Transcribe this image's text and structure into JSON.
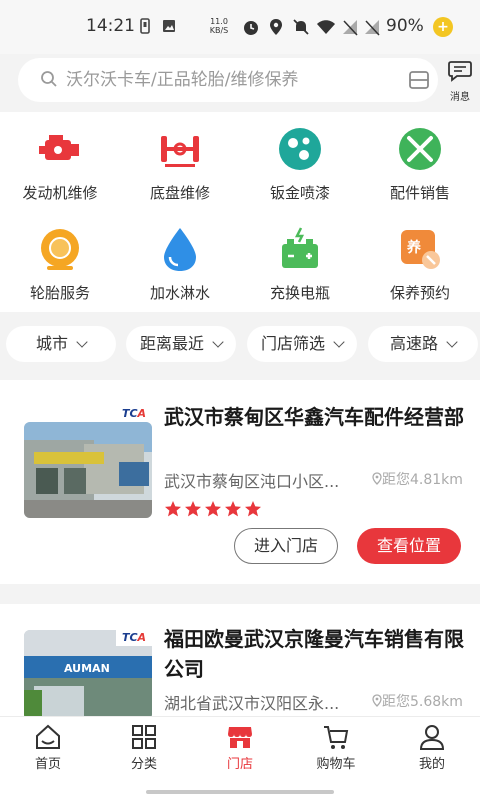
{
  "status_bar": {
    "time": "14:21",
    "network_speed": "11.0 KB/S",
    "battery": "90%"
  },
  "search": {
    "placeholder": "沃尔沃卡车/正品轮胎/维修保养",
    "message_label": "消息"
  },
  "categories": [
    {
      "label": "发动机维修",
      "icon": "engine-icon"
    },
    {
      "label": "底盘维修",
      "icon": "chassis-icon"
    },
    {
      "label": "钣金喷漆",
      "icon": "paint-icon"
    },
    {
      "label": "配件销售",
      "icon": "parts-icon"
    },
    {
      "label": "轮胎服务",
      "icon": "tire-icon"
    },
    {
      "label": "加水淋水",
      "icon": "water-drop-icon"
    },
    {
      "label": "充换电瓶",
      "icon": "battery-icon"
    },
    {
      "label": "保养预约",
      "icon": "maintenance-icon"
    }
  ],
  "filters": [
    {
      "label": "城市"
    },
    {
      "label": "距离最近"
    },
    {
      "label": "门店筛选"
    },
    {
      "label": "高速路"
    }
  ],
  "stores": [
    {
      "name": "武汉市蔡甸区华鑫汽车配件经营部",
      "address": "武汉市蔡甸区沌口小区...",
      "distance": "距您4.81km",
      "rating": 5,
      "badge": "TCA",
      "enter_label": "进入门店",
      "location_label": "查看位置"
    },
    {
      "name": "福田欧曼武汉京隆曼汽车销售有限公司",
      "address": "湖北省武汉市汉阳区永...",
      "distance": "距您5.68km",
      "badge": "TCA"
    }
  ],
  "tabs": [
    {
      "label": "首页",
      "icon": "home-icon"
    },
    {
      "label": "分类",
      "icon": "category-icon"
    },
    {
      "label": "门店",
      "icon": "store-icon",
      "active": true
    },
    {
      "label": "购物车",
      "icon": "cart-icon"
    },
    {
      "label": "我的",
      "icon": "profile-icon"
    }
  ],
  "colors": {
    "accent": "#e8373c",
    "background": "#f3f3f3",
    "badge_blue": "#1a3d8f"
  }
}
